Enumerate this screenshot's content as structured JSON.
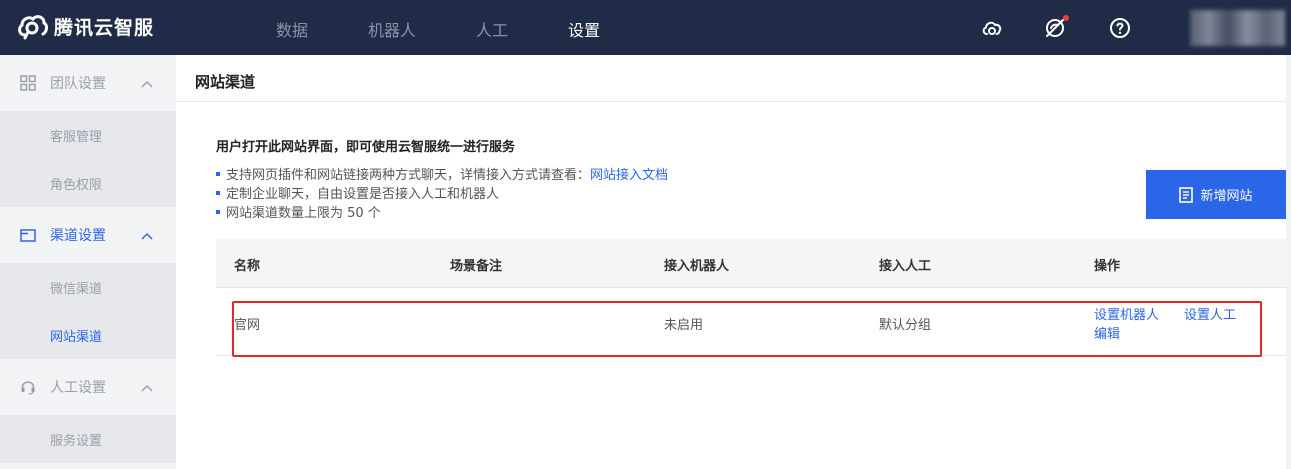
{
  "app": {
    "logo_text": "腾讯云智服"
  },
  "topnav": {
    "items": [
      {
        "label": "数据",
        "active": false
      },
      {
        "label": "机器人",
        "active": false
      },
      {
        "label": "人工",
        "active": false
      },
      {
        "label": "设置",
        "active": true
      }
    ],
    "icons": [
      "cloud-icon",
      "notification-off-icon",
      "help-icon"
    ]
  },
  "sidebar": {
    "groups": [
      {
        "icon": "grid-icon",
        "label": "团队设置",
        "expanded": true,
        "items": [
          {
            "label": "客服管理"
          },
          {
            "label": "角色权限"
          }
        ]
      },
      {
        "icon": "window-icon",
        "label": "渠道设置",
        "expanded": true,
        "active": true,
        "items": [
          {
            "label": "微信渠道"
          },
          {
            "label": "网站渠道",
            "active": true
          }
        ]
      },
      {
        "icon": "headset-icon",
        "label": "人工设置",
        "expanded": true,
        "items": [
          {
            "label": "服务设置"
          }
        ]
      }
    ]
  },
  "main": {
    "title": "网站渠道",
    "info": {
      "heading": "用户打开此网站界面，即可使用云智服统一进行服务",
      "bullet1_text": "支持网页插件和网站链接两种方式聊天，详情接入方式请查看：",
      "bullet1_link": "网站接入文档",
      "bullet2": "定制企业聊天，自由设置是否接入人工和机器人",
      "bullet3": "网站渠道数量上限为 50 个"
    },
    "add_button": "新增网站",
    "table": {
      "columns": [
        "名称",
        "场景备注",
        "接入机器人",
        "接入人工",
        "操作"
      ],
      "rows": [
        {
          "name": "官网",
          "note": "",
          "robot": "未启用",
          "agent": "默认分组",
          "actions": [
            "设置机器人",
            "设置人工",
            "编辑"
          ]
        }
      ]
    }
  },
  "colors": {
    "topbar": "#1f2b47",
    "accent": "#2c66e8",
    "highlight": "#e8242b",
    "sidebar": "#f2f3f5"
  }
}
